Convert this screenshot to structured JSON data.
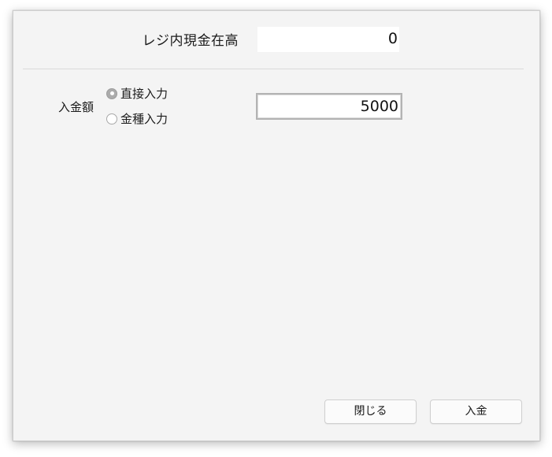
{
  "cash_on_hand": {
    "label": "レジ内現金在高",
    "value": "0"
  },
  "deposit": {
    "label": "入金額",
    "options": [
      {
        "label": "直接入力",
        "selected": true
      },
      {
        "label": "金種入力",
        "selected": false
      }
    ],
    "amount": "5000"
  },
  "buttons": {
    "close_label": "閉じる",
    "deposit_label": "入金"
  }
}
